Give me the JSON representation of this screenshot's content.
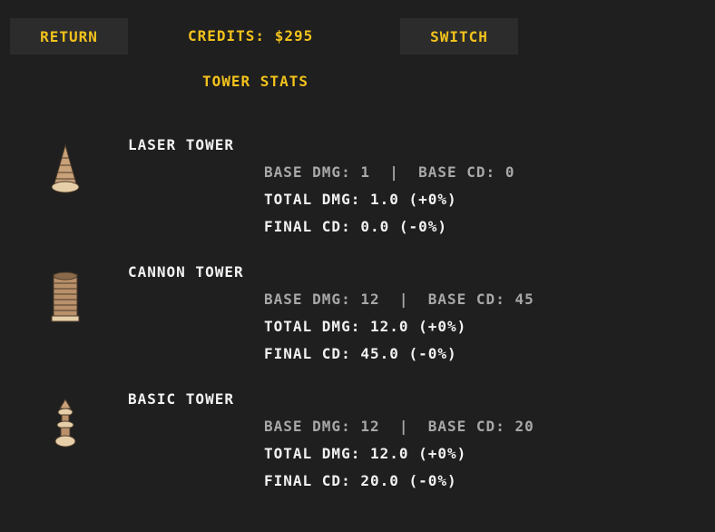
{
  "header": {
    "return_label": "RETURN",
    "credits": "CREDITS: $295",
    "switch_label": "SWITCH"
  },
  "title": "TOWER STATS",
  "towers": [
    {
      "name": "LASER TOWER",
      "icon": "laser-tower-icon",
      "base": "BASE DMG: 1  |  BASE CD: 0",
      "total": "TOTAL DMG: 1.0 (+0%)",
      "final": "FINAL CD: 0.0 (-0%)"
    },
    {
      "name": "CANNON TOWER",
      "icon": "cannon-tower-icon",
      "base": "BASE DMG: 12  |  BASE CD: 45",
      "total": "TOTAL DMG: 12.0 (+0%)",
      "final": "FINAL CD: 45.0 (-0%)"
    },
    {
      "name": "BASIC TOWER",
      "icon": "basic-tower-icon",
      "base": "BASE DMG: 12  |  BASE CD: 20",
      "total": "TOTAL DMG: 12.0 (+0%)",
      "final": "FINAL CD: 20.0 (-0%)"
    }
  ]
}
